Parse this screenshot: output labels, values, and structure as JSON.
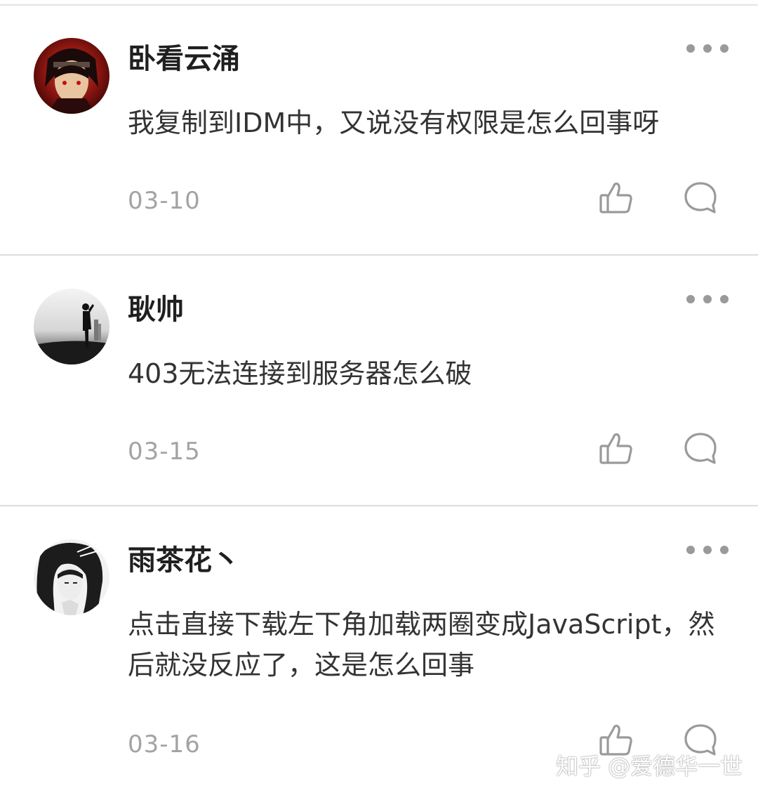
{
  "comments": [
    {
      "author": "卧看云涌",
      "text": "我复制到IDM中，又说没有权限是怎么回事呀",
      "date": "03-10"
    },
    {
      "author": "耿帅",
      "text": "403无法连接到服务器怎么破",
      "date": "03-15"
    },
    {
      "author": "雨茶花丶",
      "text": "点击直接下载左下角加载两圈变成JavaScript，然后就没反应了，这是怎么回事",
      "date": "03-16"
    }
  ],
  "icons": {
    "more": "more-options-icon",
    "like": "thumbs-up-icon",
    "reply": "comment-bubble-icon"
  },
  "colors": {
    "icon_gray": "#9a9a9a",
    "date_gray": "#a3a3a3",
    "divider": "#dcdcdc"
  },
  "watermark": "知乎 @爱德华一世"
}
